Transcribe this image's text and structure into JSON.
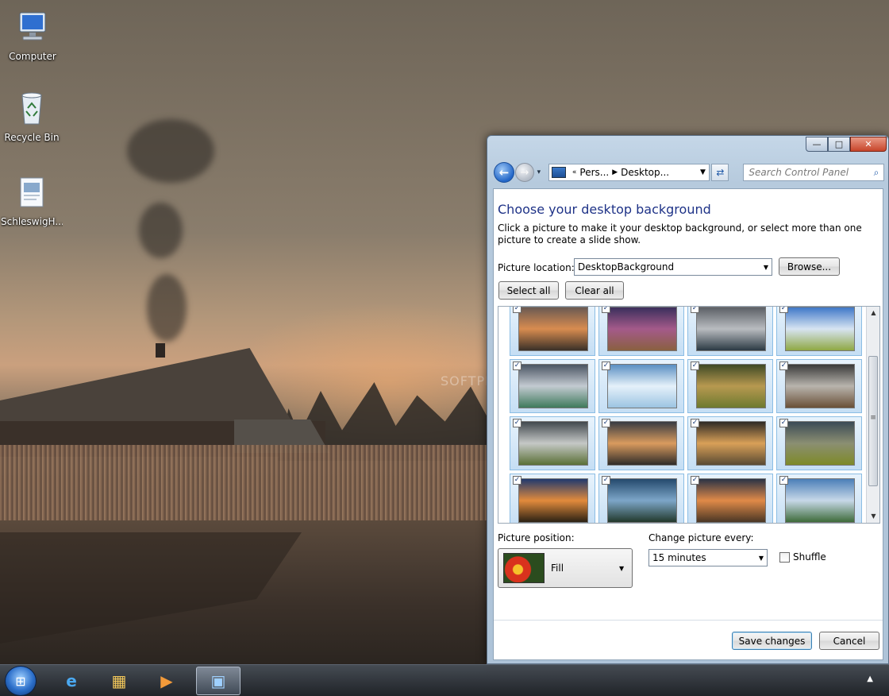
{
  "desktop": {
    "icons": [
      {
        "label": "Computer",
        "icon": "computer-icon"
      },
      {
        "label": "Recycle Bin",
        "icon": "recycle-bin-icon"
      },
      {
        "label": "SchleswigH...",
        "icon": "file-icon"
      }
    ],
    "watermark": "SOFTPEDIA"
  },
  "window": {
    "caption": {
      "minimize": "—",
      "maximize": "□",
      "close": "✕"
    },
    "nav": {
      "back": "←",
      "forward": "→",
      "history": "▾",
      "chevron": "«",
      "crumbs": [
        "Pers...",
        "Desktop..."
      ],
      "crumb_sep": "▶",
      "address_drop": "▼",
      "refresh": "⇄",
      "search_placeholder": "Search Control Panel",
      "search_icon": "⌕"
    },
    "heading": "Choose your desktop background",
    "description": "Click a picture to make it your desktop background, or select more than one picture to create a slide show.",
    "picture_location_label": "Picture location:",
    "picture_location_value": "DesktopBackground",
    "browse_label": "Browse...",
    "select_all_label": "Select all",
    "clear_all_label": "Clear all",
    "thumbnails": [
      {
        "checked": "✓",
        "colors": [
          "#6b5a52",
          "#d88c50",
          "#3a3028"
        ]
      },
      {
        "checked": "✓",
        "colors": [
          "#3b2f5c",
          "#a45a8a",
          "#8a6040"
        ]
      },
      {
        "checked": "✓",
        "colors": [
          "#5c6066",
          "#b9bcc0",
          "#2c3a44"
        ]
      },
      {
        "checked": "✓",
        "colors": [
          "#3f78c8",
          "#d7e4f2",
          "#8fa843"
        ]
      },
      {
        "checked": "✓",
        "colors": [
          "#4b5563",
          "#c3cad1",
          "#3f7a5c"
        ]
      },
      {
        "checked": "✓",
        "colors": [
          "#5a8fc2",
          "#e5f1fa",
          "#9cc4e2"
        ]
      },
      {
        "checked": "✓",
        "colors": [
          "#3f4a25",
          "#b79950",
          "#6e7a2f"
        ]
      },
      {
        "checked": "✓",
        "colors": [
          "#3a3a3a",
          "#b8b4ad",
          "#6a5038"
        ]
      },
      {
        "checked": "✓",
        "colors": [
          "#41484e",
          "#c5c8c6",
          "#5a7037"
        ]
      },
      {
        "checked": "✓",
        "colors": [
          "#373b42",
          "#d99b5e",
          "#2e2b29"
        ]
      },
      {
        "checked": "✓",
        "colors": [
          "#2e2a25",
          "#d9a058",
          "#5a4a33"
        ]
      },
      {
        "checked": "✓",
        "colors": [
          "#3b4a56",
          "#8b8f72",
          "#7e8a28"
        ]
      },
      {
        "checked": "✓",
        "colors": [
          "#213a6e",
          "#e28b3c",
          "#2b2114"
        ]
      },
      {
        "checked": "✓",
        "colors": [
          "#24496d",
          "#7da6c8",
          "#22392c"
        ]
      },
      {
        "checked": "✓",
        "colors": [
          "#2b3345",
          "#e08a48",
          "#4a3625"
        ]
      },
      {
        "checked": "✓",
        "colors": [
          "#4b7fb8",
          "#c7d8e8",
          "#3e6b3a"
        ]
      }
    ],
    "picture_position_label": "Picture position:",
    "picture_position_value": "Fill",
    "change_picture_label": "Change picture every:",
    "change_picture_value": "15 minutes",
    "shuffle_label": "Shuffle",
    "save_label": "Save changes",
    "cancel_label": "Cancel",
    "scroll": {
      "up": "▲",
      "down": "▼",
      "grip": "≡"
    },
    "dropdown_arrow": "▼"
  },
  "taskbar": {
    "start": "⊞",
    "tray_arrow": "▲",
    "buttons": [
      {
        "name": "ie-button",
        "glyph": "e",
        "color": "#4aa8f0"
      },
      {
        "name": "explorer-button",
        "glyph": "▦",
        "color": "#f2c75a"
      },
      {
        "name": "media-player-button",
        "glyph": "▶",
        "color": "#f29a3a"
      },
      {
        "name": "control-panel-button",
        "glyph": "▣",
        "color": "#9fd0ff"
      }
    ]
  }
}
